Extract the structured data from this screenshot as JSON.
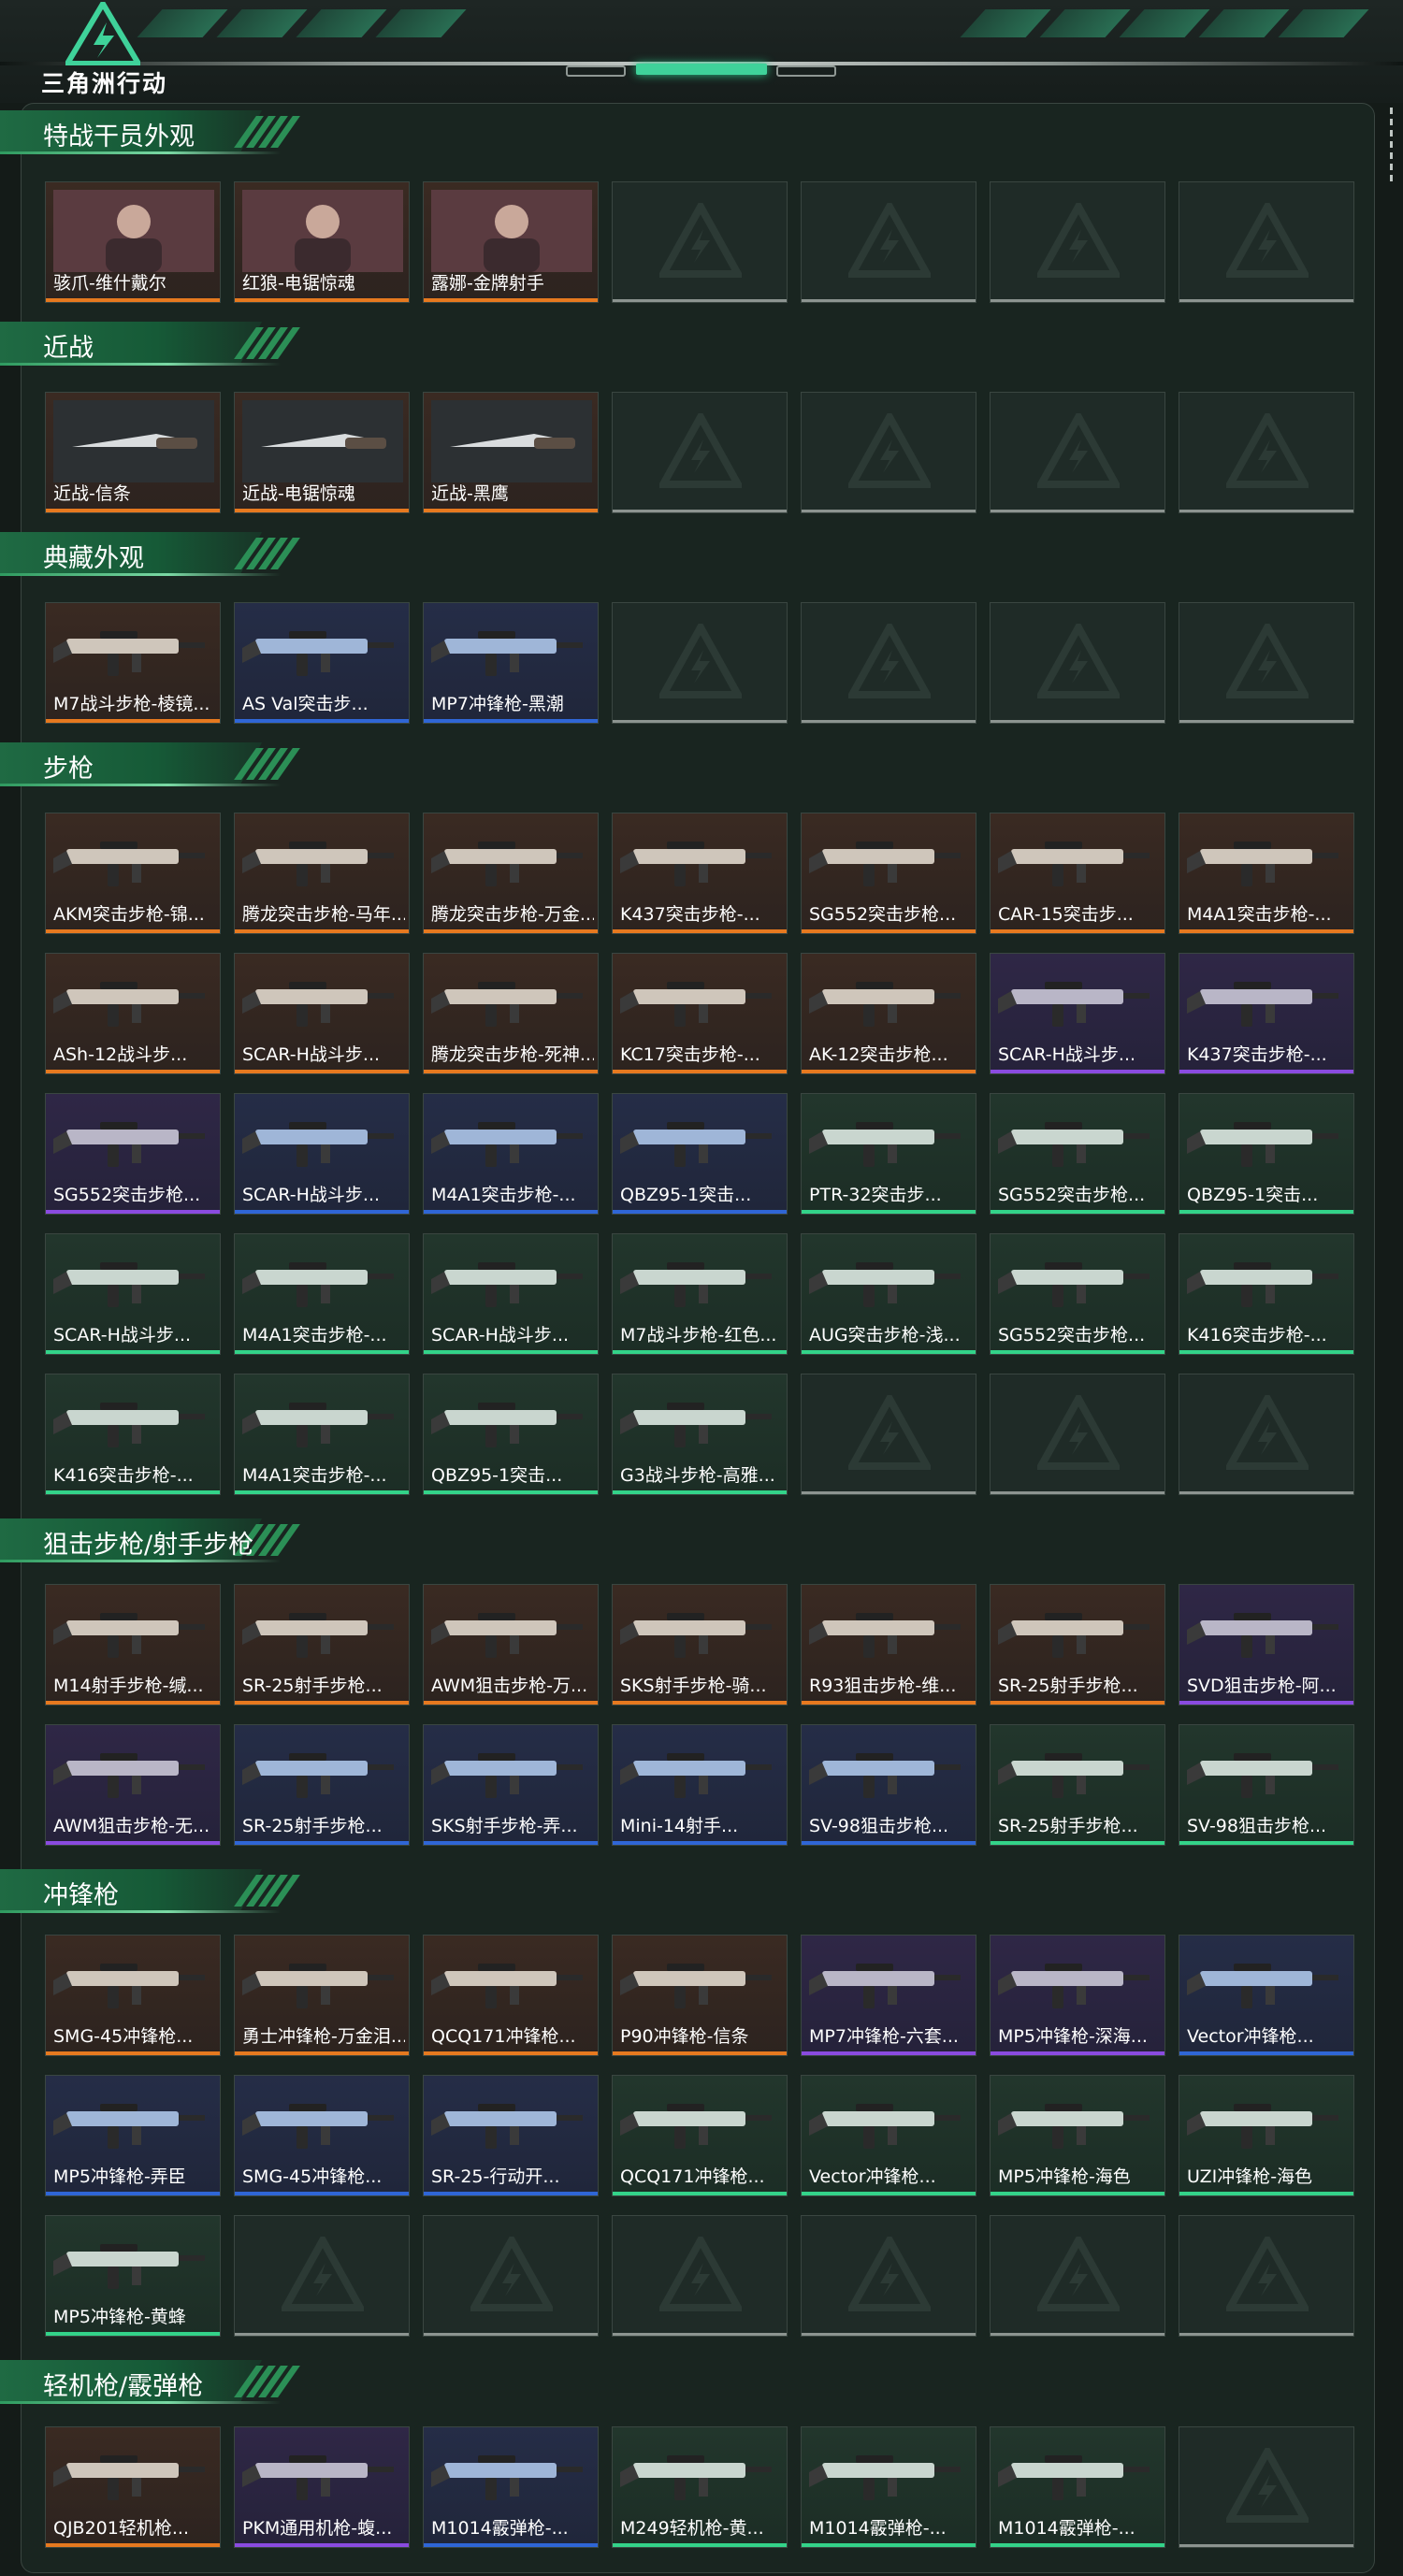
{
  "app": {
    "logo_text": "三角洲行动"
  },
  "colors": {
    "orange": "#e6791f",
    "purple": "#8a4be0",
    "blue": "#2f66d6",
    "green": "#33d389",
    "empty_edge": "#8c9490",
    "accent": "#3fd29a"
  },
  "sections": [
    {
      "title": "特战干员外观",
      "items": [
        {
          "label": "骇爪-维什戴尔",
          "rarity": "orange",
          "kind": "agent"
        },
        {
          "label": "红狼-电锯惊魂",
          "rarity": "orange",
          "kind": "agent"
        },
        {
          "label": "露娜-金牌射手",
          "rarity": "orange",
          "kind": "agent"
        },
        {
          "empty": true
        },
        {
          "empty": true
        },
        {
          "empty": true
        },
        {
          "empty": true
        }
      ]
    },
    {
      "title": "近战",
      "items": [
        {
          "label": "近战-信条",
          "rarity": "orange",
          "kind": "melee"
        },
        {
          "label": "近战-电锯惊魂",
          "rarity": "orange",
          "kind": "melee"
        },
        {
          "label": "近战-黑鹰",
          "rarity": "orange",
          "kind": "melee"
        },
        {
          "empty": true
        },
        {
          "empty": true
        },
        {
          "empty": true
        },
        {
          "empty": true
        }
      ]
    },
    {
      "title": "典藏外观",
      "items": [
        {
          "label": "M7战斗步枪-棱镜...",
          "rarity": "orange",
          "kind": "gun"
        },
        {
          "label": "AS Val突击步...",
          "rarity": "blue",
          "kind": "gun"
        },
        {
          "label": "MP7冲锋枪-黑潮",
          "rarity": "blue",
          "kind": "gun"
        },
        {
          "empty": true
        },
        {
          "empty": true
        },
        {
          "empty": true
        },
        {
          "empty": true
        }
      ]
    },
    {
      "title": "步枪",
      "items": [
        {
          "label": "AKM突击步枪-锦...",
          "rarity": "orange",
          "kind": "gun"
        },
        {
          "label": "腾龙突击步枪-马年...",
          "rarity": "orange",
          "kind": "gun"
        },
        {
          "label": "腾龙突击步枪-万金...",
          "rarity": "orange",
          "kind": "gun"
        },
        {
          "label": "K437突击步枪-...",
          "rarity": "orange",
          "kind": "gun"
        },
        {
          "label": "SG552突击步枪...",
          "rarity": "orange",
          "kind": "gun"
        },
        {
          "label": "CAR-15突击步...",
          "rarity": "orange",
          "kind": "gun"
        },
        {
          "label": "M4A1突击步枪-...",
          "rarity": "orange",
          "kind": "gun"
        },
        {
          "label": "ASh-12战斗步...",
          "rarity": "orange",
          "kind": "gun"
        },
        {
          "label": "SCAR-H战斗步...",
          "rarity": "orange",
          "kind": "gun"
        },
        {
          "label": "腾龙突击步枪-死神...",
          "rarity": "orange",
          "kind": "gun"
        },
        {
          "label": "KC17突击步枪-...",
          "rarity": "orange",
          "kind": "gun"
        },
        {
          "label": "AK-12突击步枪...",
          "rarity": "orange",
          "kind": "gun"
        },
        {
          "label": "SCAR-H战斗步...",
          "rarity": "purple",
          "kind": "gun"
        },
        {
          "label": "K437突击步枪-...",
          "rarity": "purple",
          "kind": "gun"
        },
        {
          "label": "SG552突击步枪...",
          "rarity": "purple",
          "kind": "gun"
        },
        {
          "label": "SCAR-H战斗步...",
          "rarity": "blue",
          "kind": "gun"
        },
        {
          "label": "M4A1突击步枪-...",
          "rarity": "blue",
          "kind": "gun"
        },
        {
          "label": "QBZ95-1突击...",
          "rarity": "blue",
          "kind": "gun"
        },
        {
          "label": "PTR-32突击步...",
          "rarity": "green",
          "kind": "gun"
        },
        {
          "label": "SG552突击步枪...",
          "rarity": "green",
          "kind": "gun"
        },
        {
          "label": "QBZ95-1突击...",
          "rarity": "green",
          "kind": "gun"
        },
        {
          "label": "SCAR-H战斗步...",
          "rarity": "green",
          "kind": "gun"
        },
        {
          "label": "M4A1突击步枪-...",
          "rarity": "green",
          "kind": "gun"
        },
        {
          "label": "SCAR-H战斗步...",
          "rarity": "green",
          "kind": "gun"
        },
        {
          "label": "M7战斗步枪-红色...",
          "rarity": "green",
          "kind": "gun"
        },
        {
          "label": "AUG突击步枪-浅...",
          "rarity": "green",
          "kind": "gun"
        },
        {
          "label": "SG552突击步枪...",
          "rarity": "green",
          "kind": "gun"
        },
        {
          "label": "K416突击步枪-...",
          "rarity": "green",
          "kind": "gun"
        },
        {
          "label": "K416突击步枪-...",
          "rarity": "green",
          "kind": "gun"
        },
        {
          "label": "M4A1突击步枪-...",
          "rarity": "green",
          "kind": "gun"
        },
        {
          "label": "QBZ95-1突击...",
          "rarity": "green",
          "kind": "gun"
        },
        {
          "label": "G3战斗步枪-高雅...",
          "rarity": "green",
          "kind": "gun"
        },
        {
          "empty": true
        },
        {
          "empty": true
        },
        {
          "empty": true
        }
      ]
    },
    {
      "title": "狙击步枪/射手步枪",
      "items": [
        {
          "label": "M14射手步枪-缄...",
          "rarity": "orange",
          "kind": "gun"
        },
        {
          "label": "SR-25射手步枪...",
          "rarity": "orange",
          "kind": "gun"
        },
        {
          "label": "AWM狙击步枪-万...",
          "rarity": "orange",
          "kind": "gun"
        },
        {
          "label": "SKS射手步枪-骑...",
          "rarity": "orange",
          "kind": "gun"
        },
        {
          "label": "R93狙击步枪-维...",
          "rarity": "orange",
          "kind": "gun"
        },
        {
          "label": "SR-25射手步枪...",
          "rarity": "orange",
          "kind": "gun"
        },
        {
          "label": "SVD狙击步枪-阿...",
          "rarity": "purple",
          "kind": "gun"
        },
        {
          "label": "AWM狙击步枪-无...",
          "rarity": "purple",
          "kind": "gun"
        },
        {
          "label": "SR-25射手步枪...",
          "rarity": "blue",
          "kind": "gun"
        },
        {
          "label": "SKS射手步枪-弄...",
          "rarity": "blue",
          "kind": "gun"
        },
        {
          "label": "Mini-14射手...",
          "rarity": "blue",
          "kind": "gun"
        },
        {
          "label": "SV-98狙击步枪...",
          "rarity": "blue",
          "kind": "gun"
        },
        {
          "label": "SR-25射手步枪...",
          "rarity": "green",
          "kind": "gun"
        },
        {
          "label": "SV-98狙击步枪...",
          "rarity": "green",
          "kind": "gun"
        }
      ]
    },
    {
      "title": "冲锋枪",
      "items": [
        {
          "label": "SMG-45冲锋枪...",
          "rarity": "orange",
          "kind": "gun"
        },
        {
          "label": "勇士冲锋枪-万金泪...",
          "rarity": "orange",
          "kind": "gun"
        },
        {
          "label": "QCQ171冲锋枪...",
          "rarity": "orange",
          "kind": "gun"
        },
        {
          "label": "P90冲锋枪-信条",
          "rarity": "orange",
          "kind": "gun"
        },
        {
          "label": "MP7冲锋枪-六套...",
          "rarity": "purple",
          "kind": "gun"
        },
        {
          "label": "MP5冲锋枪-深海...",
          "rarity": "purple",
          "kind": "gun"
        },
        {
          "label": "Vector冲锋枪...",
          "rarity": "blue",
          "kind": "gun"
        },
        {
          "label": "MP5冲锋枪-弄臣",
          "rarity": "blue",
          "kind": "gun"
        },
        {
          "label": "SMG-45冲锋枪...",
          "rarity": "blue",
          "kind": "gun"
        },
        {
          "label": "SR-25-行动开...",
          "rarity": "blue",
          "kind": "gun"
        },
        {
          "label": "QCQ171冲锋枪...",
          "rarity": "green",
          "kind": "gun"
        },
        {
          "label": "Vector冲锋枪...",
          "rarity": "green",
          "kind": "gun"
        },
        {
          "label": "MP5冲锋枪-海色",
          "rarity": "green",
          "kind": "gun"
        },
        {
          "label": "UZI冲锋枪-海色",
          "rarity": "green",
          "kind": "gun"
        },
        {
          "label": "MP5冲锋枪-黄蜂",
          "rarity": "green",
          "kind": "gun"
        },
        {
          "empty": true
        },
        {
          "empty": true
        },
        {
          "empty": true
        },
        {
          "empty": true
        },
        {
          "empty": true
        },
        {
          "empty": true
        }
      ]
    },
    {
      "title": "轻机枪/霰弹枪",
      "items": [
        {
          "label": "QJB201轻机枪...",
          "rarity": "orange",
          "kind": "gun"
        },
        {
          "label": "PKM通用机枪-蝮...",
          "rarity": "purple",
          "kind": "gun"
        },
        {
          "label": "M1014霰弹枪-...",
          "rarity": "blue",
          "kind": "gun"
        },
        {
          "label": "M249轻机枪-黄...",
          "rarity": "green",
          "kind": "gun"
        },
        {
          "label": "M1014霰弹枪-...",
          "rarity": "green",
          "kind": "gun"
        },
        {
          "label": "M1014霰弹枪-...",
          "rarity": "green",
          "kind": "gun"
        },
        {
          "empty": true
        }
      ]
    }
  ]
}
